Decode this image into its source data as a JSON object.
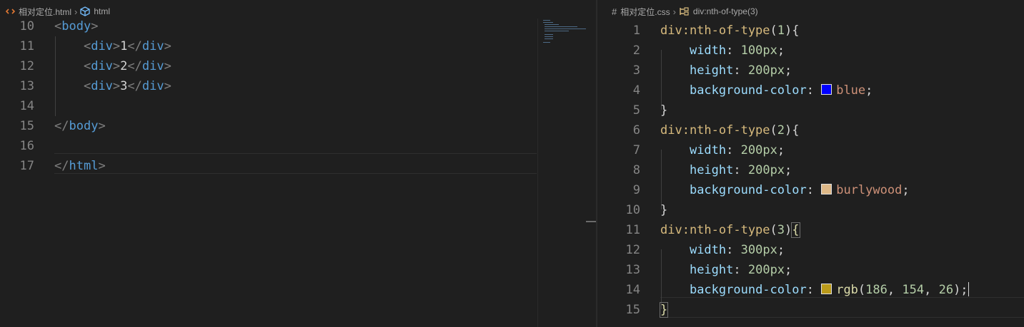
{
  "left_editor": {
    "breadcrumb": {
      "file_icon": "html-file-icon",
      "file": "相对定位.html",
      "separator": "›",
      "symbol_icon": "cube-icon",
      "symbol": "html"
    },
    "lines": [
      {
        "n": "10",
        "tokens": [
          [
            "tag-br",
            "<"
          ],
          [
            "tag",
            "body"
          ],
          [
            "tag-br",
            ">"
          ]
        ]
      },
      {
        "n": "11",
        "tokens": [
          [
            "txt",
            "    "
          ],
          [
            "tag-br",
            "<"
          ],
          [
            "tag",
            "div"
          ],
          [
            "tag-br",
            ">"
          ],
          [
            "txt",
            "1"
          ],
          [
            "tag-br",
            "</"
          ],
          [
            "tag",
            "div"
          ],
          [
            "tag-br",
            ">"
          ]
        ]
      },
      {
        "n": "12",
        "tokens": [
          [
            "txt",
            "    "
          ],
          [
            "tag-br",
            "<"
          ],
          [
            "tag",
            "div"
          ],
          [
            "tag-br",
            ">"
          ],
          [
            "txt",
            "2"
          ],
          [
            "tag-br",
            "</"
          ],
          [
            "tag",
            "div"
          ],
          [
            "tag-br",
            ">"
          ]
        ]
      },
      {
        "n": "13",
        "tokens": [
          [
            "txt",
            "    "
          ],
          [
            "tag-br",
            "<"
          ],
          [
            "tag",
            "div"
          ],
          [
            "tag-br",
            ">"
          ],
          [
            "txt",
            "3"
          ],
          [
            "tag-br",
            "</"
          ],
          [
            "tag",
            "div"
          ],
          [
            "tag-br",
            ">"
          ]
        ]
      },
      {
        "n": "14",
        "tokens": []
      },
      {
        "n": "15",
        "tokens": [
          [
            "tag-br",
            "</"
          ],
          [
            "tag",
            "body"
          ],
          [
            "tag-br",
            ">"
          ]
        ]
      },
      {
        "n": "16",
        "tokens": []
      },
      {
        "n": "17",
        "tokens": [
          [
            "tag-br",
            "</"
          ],
          [
            "tag",
            "html"
          ],
          [
            "tag-br",
            ">"
          ]
        ]
      }
    ]
  },
  "right_editor": {
    "breadcrumb": {
      "file_icon": "hash-icon",
      "file": "相对定位.css",
      "separator": "›",
      "symbol_icon": "selector-icon",
      "symbol": "div:nth-of-type(3)"
    },
    "lines": [
      {
        "n": "1",
        "tokens": [
          [
            "sel",
            "div:nth-of-type"
          ],
          [
            "punc",
            "("
          ],
          [
            "num",
            "1"
          ],
          [
            "punc",
            ")"
          ],
          [
            "punc",
            "{"
          ]
        ]
      },
      {
        "n": "2",
        "tokens": [
          [
            "txt",
            "    "
          ],
          [
            "prop",
            "width"
          ],
          [
            "punc",
            ": "
          ],
          [
            "num",
            "100px"
          ],
          [
            "punc",
            ";"
          ]
        ]
      },
      {
        "n": "3",
        "tokens": [
          [
            "txt",
            "    "
          ],
          [
            "prop",
            "height"
          ],
          [
            "punc",
            ": "
          ],
          [
            "num",
            "200px"
          ],
          [
            "punc",
            ";"
          ]
        ]
      },
      {
        "n": "4",
        "tokens": [
          [
            "txt",
            "    "
          ],
          [
            "prop",
            "background-color"
          ],
          [
            "punc",
            ": "
          ],
          [
            "swatch",
            "#0000ff"
          ],
          [
            "val",
            "blue"
          ],
          [
            "punc",
            ";"
          ]
        ]
      },
      {
        "n": "5",
        "tokens": [
          [
            "punc",
            "}"
          ]
        ]
      },
      {
        "n": "6",
        "tokens": [
          [
            "sel",
            "div:nth-of-type"
          ],
          [
            "punc",
            "("
          ],
          [
            "num",
            "2"
          ],
          [
            "punc",
            ")"
          ],
          [
            "punc",
            "{"
          ]
        ]
      },
      {
        "n": "7",
        "tokens": [
          [
            "txt",
            "    "
          ],
          [
            "prop",
            "width"
          ],
          [
            "punc",
            ": "
          ],
          [
            "num",
            "200px"
          ],
          [
            "punc",
            ";"
          ]
        ]
      },
      {
        "n": "8",
        "tokens": [
          [
            "txt",
            "    "
          ],
          [
            "prop",
            "height"
          ],
          [
            "punc",
            ": "
          ],
          [
            "num",
            "200px"
          ],
          [
            "punc",
            ";"
          ]
        ]
      },
      {
        "n": "9",
        "tokens": [
          [
            "txt",
            "    "
          ],
          [
            "prop",
            "background-color"
          ],
          [
            "punc",
            ": "
          ],
          [
            "swatch",
            "#deb887"
          ],
          [
            "val",
            "burlywood"
          ],
          [
            "punc",
            ";"
          ]
        ]
      },
      {
        "n": "10",
        "tokens": [
          [
            "punc",
            "}"
          ]
        ]
      },
      {
        "n": "11",
        "tokens": [
          [
            "sel",
            "div:nth-of-type"
          ],
          [
            "punc",
            "("
          ],
          [
            "num",
            "3"
          ],
          [
            "punc",
            ")"
          ],
          [
            "bracket",
            "{"
          ]
        ]
      },
      {
        "n": "12",
        "tokens": [
          [
            "txt",
            "    "
          ],
          [
            "prop",
            "width"
          ],
          [
            "punc",
            ": "
          ],
          [
            "num",
            "300px"
          ],
          [
            "punc",
            ";"
          ]
        ]
      },
      {
        "n": "13",
        "tokens": [
          [
            "txt",
            "    "
          ],
          [
            "prop",
            "height"
          ],
          [
            "punc",
            ": "
          ],
          [
            "num",
            "200px"
          ],
          [
            "punc",
            ";"
          ]
        ]
      },
      {
        "n": "14",
        "tokens": [
          [
            "txt",
            "    "
          ],
          [
            "prop",
            "background-color"
          ],
          [
            "punc",
            ": "
          ],
          [
            "swatch",
            "#ba9a1a"
          ],
          [
            "fn",
            "rgb"
          ],
          [
            "punc",
            "("
          ],
          [
            "num",
            "186"
          ],
          [
            "punc",
            ", "
          ],
          [
            "num",
            "154"
          ],
          [
            "punc",
            ", "
          ],
          [
            "num",
            "26"
          ],
          [
            "punc",
            ");"
          ],
          [
            "cursor",
            ""
          ]
        ]
      },
      {
        "n": "15",
        "tokens": [
          [
            "bracket",
            "}"
          ]
        ]
      }
    ]
  },
  "colors": {
    "background": "#1f1f1f",
    "tag": "#569cd6",
    "selector": "#d7ba7d",
    "property": "#9cdcfe",
    "number": "#b5cea8",
    "value": "#ce9178"
  }
}
